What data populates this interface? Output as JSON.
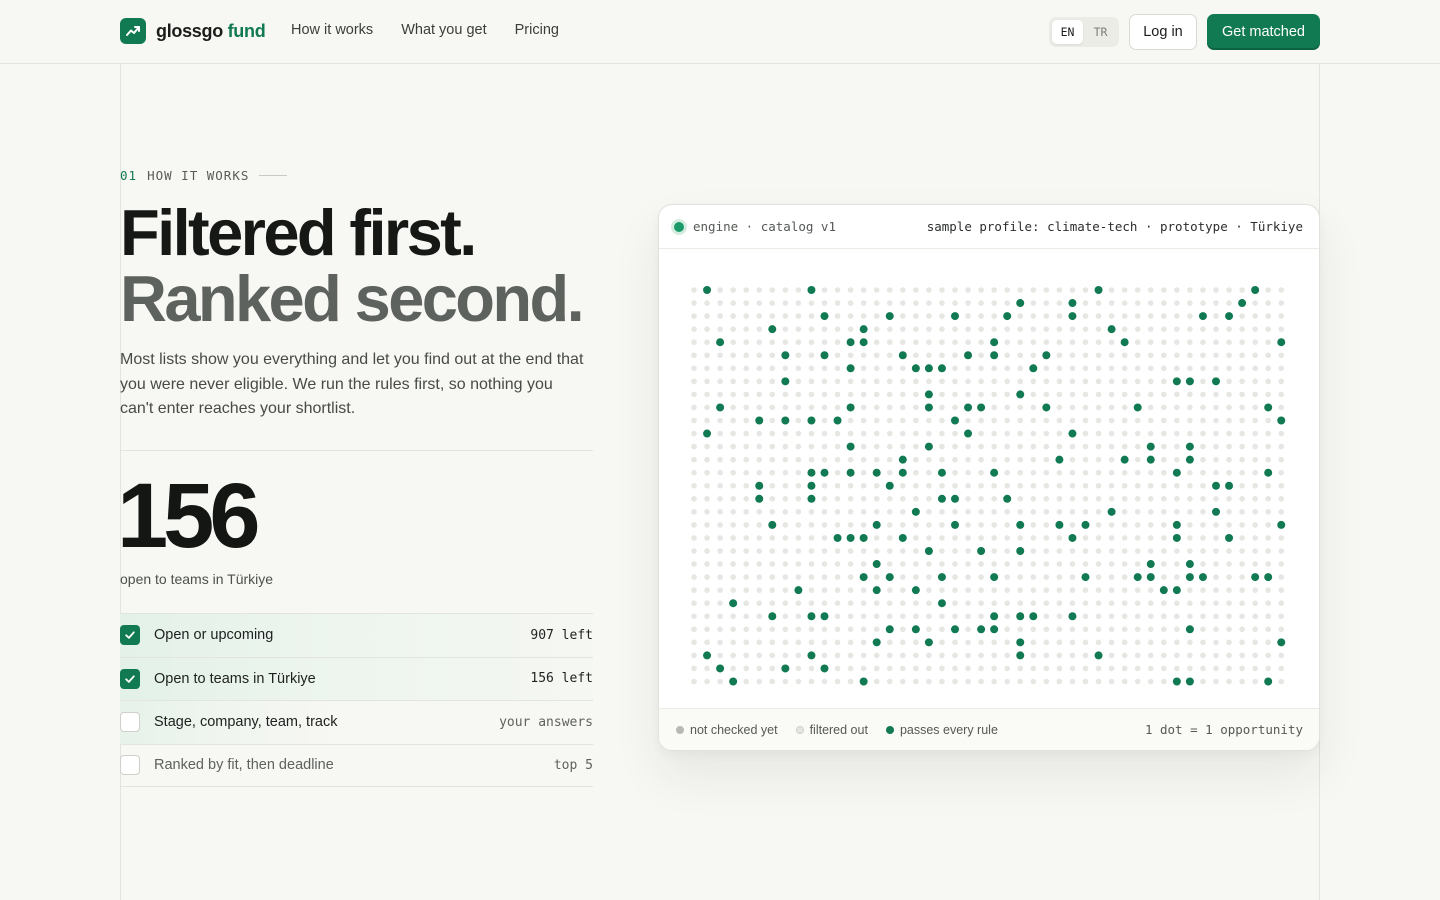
{
  "nav": {
    "brand_primary": "glossgo",
    "brand_accent": "fund",
    "links": [
      "How it works",
      "What you get",
      "Pricing"
    ],
    "lang_options": [
      "EN",
      "TR"
    ],
    "lang_active": "EN",
    "login_label": "Log in",
    "cta_label": "Get matched"
  },
  "hero": {
    "section_num": "01",
    "section_label": "HOW IT WORKS",
    "headline_line1": "Filtered first.",
    "headline_line2": "Ranked second.",
    "lede": "Most lists show you everything and let you find out at the end that you were never eligible. We run the rules first, so nothing you can't enter reaches your shortlist.",
    "count": "156",
    "count_caption": "open to teams in Türkiye"
  },
  "rules": [
    {
      "label": "Open or upcoming",
      "meta": "907 left",
      "state": "checked"
    },
    {
      "label": "Open to teams in Türkiye",
      "meta": "156 left",
      "state": "checked"
    },
    {
      "label": "Stage, company, team, track",
      "meta": "your answers",
      "state": "pending"
    },
    {
      "label": "Ranked by fit, then deadline",
      "meta": "top 5",
      "state": "pending"
    }
  ],
  "card": {
    "engine_label": "engine · catalog v1",
    "profile_label": "sample profile: climate-tech · prototype · Türkiye",
    "legend": [
      {
        "label": "not checked yet",
        "color": "#b7b9b4"
      },
      {
        "label": "filtered out",
        "color": "#e4e5e0"
      },
      {
        "label": "passes every rule",
        "color": "#117a52"
      }
    ],
    "scale_note": "1 dot = 1 opportunity"
  },
  "dot_grid": {
    "cols": 46,
    "rows": 31,
    "pass_color": "#117a52",
    "filtered_color": "#e6e7e2",
    "passing": [
      [
        0,
        1
      ],
      [
        0,
        9
      ],
      [
        0,
        31
      ],
      [
        0,
        43
      ],
      [
        1,
        25
      ],
      [
        1,
        29
      ],
      [
        1,
        42
      ],
      [
        2,
        10
      ],
      [
        2,
        15
      ],
      [
        2,
        20
      ],
      [
        2,
        24
      ],
      [
        2,
        29
      ],
      [
        2,
        39
      ],
      [
        2,
        41
      ],
      [
        3,
        6
      ],
      [
        3,
        13
      ],
      [
        3,
        32
      ],
      [
        4,
        2
      ],
      [
        4,
        12
      ],
      [
        4,
        13
      ],
      [
        4,
        23
      ],
      [
        4,
        33
      ],
      [
        4,
        45
      ],
      [
        5,
        7
      ],
      [
        5,
        10
      ],
      [
        5,
        16
      ],
      [
        5,
        21
      ],
      [
        5,
        23
      ],
      [
        5,
        27
      ],
      [
        6,
        12
      ],
      [
        6,
        17
      ],
      [
        6,
        18
      ],
      [
        6,
        19
      ],
      [
        6,
        26
      ],
      [
        7,
        7
      ],
      [
        7,
        37
      ],
      [
        7,
        38
      ],
      [
        7,
        40
      ],
      [
        8,
        18
      ],
      [
        8,
        25
      ],
      [
        9,
        2
      ],
      [
        9,
        12
      ],
      [
        9,
        18
      ],
      [
        9,
        21
      ],
      [
        9,
        22
      ],
      [
        9,
        27
      ],
      [
        9,
        34
      ],
      [
        9,
        44
      ],
      [
        10,
        5
      ],
      [
        10,
        7
      ],
      [
        10,
        9
      ],
      [
        10,
        11
      ],
      [
        10,
        20
      ],
      [
        10,
        45
      ],
      [
        11,
        1
      ],
      [
        11,
        21
      ],
      [
        11,
        29
      ],
      [
        12,
        12
      ],
      [
        12,
        18
      ],
      [
        12,
        35
      ],
      [
        12,
        38
      ],
      [
        13,
        16
      ],
      [
        13,
        28
      ],
      [
        13,
        33
      ],
      [
        13,
        35
      ],
      [
        13,
        38
      ],
      [
        14,
        9
      ],
      [
        14,
        10
      ],
      [
        14,
        12
      ],
      [
        14,
        14
      ],
      [
        14,
        16
      ],
      [
        14,
        19
      ],
      [
        14,
        23
      ],
      [
        14,
        37
      ],
      [
        14,
        44
      ],
      [
        15,
        5
      ],
      [
        15,
        9
      ],
      [
        15,
        15
      ],
      [
        15,
        40
      ],
      [
        15,
        41
      ],
      [
        16,
        5
      ],
      [
        16,
        9
      ],
      [
        16,
        19
      ],
      [
        16,
        20
      ],
      [
        16,
        24
      ],
      [
        17,
        17
      ],
      [
        17,
        32
      ],
      [
        17,
        40
      ],
      [
        18,
        6
      ],
      [
        18,
        14
      ],
      [
        18,
        20
      ],
      [
        18,
        25
      ],
      [
        18,
        28
      ],
      [
        18,
        30
      ],
      [
        18,
        37
      ],
      [
        18,
        45
      ],
      [
        19,
        11
      ],
      [
        19,
        12
      ],
      [
        19,
        13
      ],
      [
        19,
        16
      ],
      [
        19,
        29
      ],
      [
        19,
        37
      ],
      [
        19,
        41
      ],
      [
        20,
        18
      ],
      [
        20,
        22
      ],
      [
        20,
        25
      ],
      [
        21,
        14
      ],
      [
        21,
        35
      ],
      [
        21,
        38
      ],
      [
        22,
        13
      ],
      [
        22,
        15
      ],
      [
        22,
        19
      ],
      [
        22,
        23
      ],
      [
        22,
        30
      ],
      [
        22,
        34
      ],
      [
        22,
        35
      ],
      [
        22,
        38
      ],
      [
        22,
        39
      ],
      [
        22,
        43
      ],
      [
        22,
        44
      ],
      [
        23,
        8
      ],
      [
        23,
        14
      ],
      [
        23,
        17
      ],
      [
        23,
        36
      ],
      [
        23,
        37
      ],
      [
        24,
        3
      ],
      [
        24,
        19
      ],
      [
        25,
        6
      ],
      [
        25,
        9
      ],
      [
        25,
        10
      ],
      [
        25,
        23
      ],
      [
        25,
        25
      ],
      [
        25,
        26
      ],
      [
        25,
        29
      ],
      [
        26,
        15
      ],
      [
        26,
        17
      ],
      [
        26,
        20
      ],
      [
        26,
        22
      ],
      [
        26,
        23
      ],
      [
        26,
        38
      ],
      [
        27,
        14
      ],
      [
        27,
        18
      ],
      [
        27,
        25
      ],
      [
        27,
        45
      ],
      [
        28,
        1
      ],
      [
        28,
        9
      ],
      [
        28,
        25
      ],
      [
        28,
        31
      ],
      [
        29,
        2
      ],
      [
        29,
        7
      ],
      [
        29,
        10
      ],
      [
        30,
        3
      ],
      [
        30,
        13
      ],
      [
        30,
        37
      ],
      [
        30,
        38
      ],
      [
        30,
        44
      ]
    ]
  }
}
